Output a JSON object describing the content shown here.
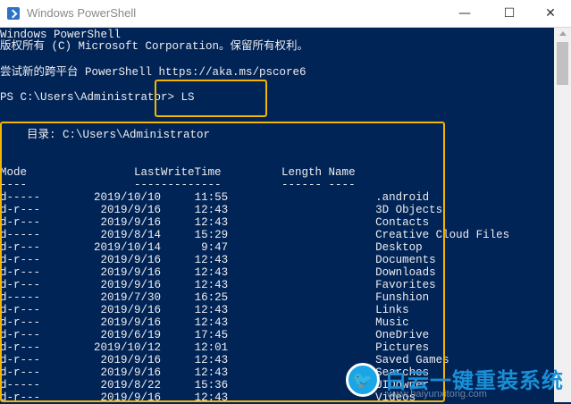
{
  "window": {
    "title": "Windows PowerShell",
    "minimize_icon": "minimize-icon",
    "maximize_icon": "maximize-icon",
    "close_icon": "close-icon",
    "minimize_glyph": "—",
    "maximize_glyph": "☐",
    "close_glyph": "✕"
  },
  "console": {
    "header_lines": [
      "Windows PowerShell",
      "版权所有 (C) Microsoft Corporation。保留所有权利。",
      "",
      "尝试新的跨平台 PowerShell https://aka.ms/pscore6",
      "",
      "PS C:\\Users\\Administrator> LS"
    ],
    "directory_line": "    目录: C:\\Users\\Administrator",
    "table_header": "Mode                LastWriteTime         Length Name",
    "table_separator": "----                -------------         ------ ----",
    "rows": [
      {
        "mode": "d-----",
        "date": "2019/10/10",
        "time": "11:55",
        "name": ".android"
      },
      {
        "mode": "d-r---",
        "date": "2019/9/16",
        "time": "12:43",
        "name": "3D Objects"
      },
      {
        "mode": "d-r---",
        "date": "2019/9/16",
        "time": "12:43",
        "name": "Contacts"
      },
      {
        "mode": "d-----",
        "date": "2019/8/14",
        "time": "15:29",
        "name": "Creative Cloud Files"
      },
      {
        "mode": "d-r---",
        "date": "2019/10/14",
        "time": "9:47",
        "name": "Desktop"
      },
      {
        "mode": "d-r---",
        "date": "2019/9/16",
        "time": "12:43",
        "name": "Documents"
      },
      {
        "mode": "d-r---",
        "date": "2019/9/16",
        "time": "12:43",
        "name": "Downloads"
      },
      {
        "mode": "d-r---",
        "date": "2019/9/16",
        "time": "12:43",
        "name": "Favorites"
      },
      {
        "mode": "d-----",
        "date": "2019/7/30",
        "time": "16:25",
        "name": "Funshion"
      },
      {
        "mode": "d-r---",
        "date": "2019/9/16",
        "time": "12:43",
        "name": "Links"
      },
      {
        "mode": "d-r---",
        "date": "2019/9/16",
        "time": "12:43",
        "name": "Music"
      },
      {
        "mode": "d-r---",
        "date": "2019/6/19",
        "time": "17:45",
        "name": "OneDrive"
      },
      {
        "mode": "d-r---",
        "date": "2019/10/12",
        "time": "12:01",
        "name": "Pictures"
      },
      {
        "mode": "d-r---",
        "date": "2019/9/16",
        "time": "12:43",
        "name": "Saved Games"
      },
      {
        "mode": "d-r---",
        "date": "2019/9/16",
        "time": "12:43",
        "name": "Searches"
      },
      {
        "mode": "d-----",
        "date": "2019/8/22",
        "time": "15:36",
        "name": "UIDowner"
      },
      {
        "mode": "d-r---",
        "date": "2019/9/16",
        "time": "12:43",
        "name": "Videos"
      }
    ]
  },
  "watermark": {
    "title": "白云一键重装系统",
    "url": "www.baiyunxitong.com",
    "icon": "twitter-bird-icon",
    "glyph": "🐦"
  },
  "colors": {
    "console_bg": "#012456",
    "console_text": "#eeedf0",
    "highlight": "#f4b400",
    "watermark_blue": "#1a8fd6"
  }
}
